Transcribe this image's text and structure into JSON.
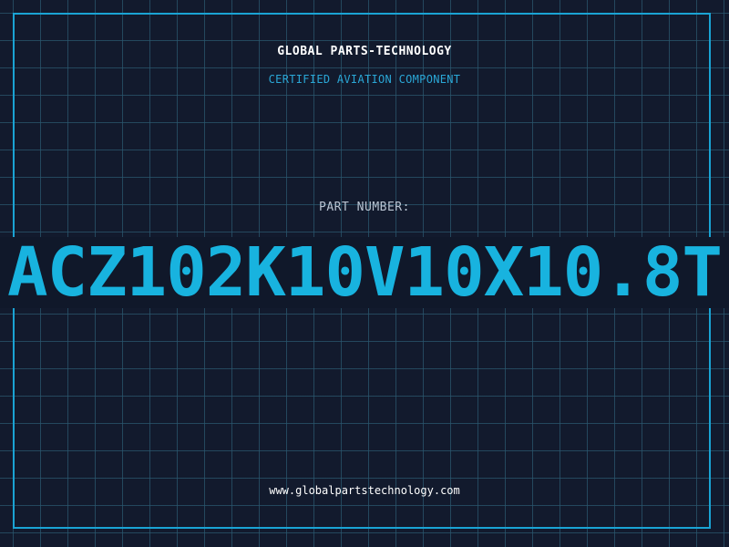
{
  "header": {
    "company": "GLOBAL PARTS-TECHNOLOGY",
    "subtitle": "CERTIFIED AVIATION COMPONENT"
  },
  "part": {
    "label": "PART NUMBER:",
    "number": "ACZ102K10V10X10.8T"
  },
  "footer": {
    "url": "www.globalpartstechnology.com"
  },
  "colors": {
    "background": "#11192b",
    "grid": "#2a566e",
    "accent": "#1aa3d4",
    "part_number": "#18b3df",
    "text": "#ffffff"
  }
}
